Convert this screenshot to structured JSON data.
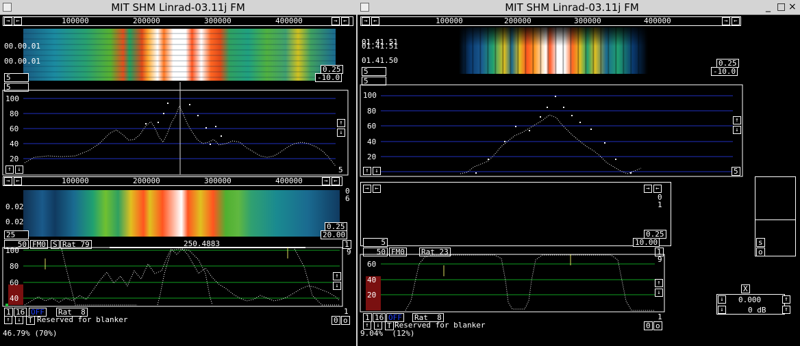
{
  "left": {
    "title": "MIT SHM Linrad-03.11j FM",
    "freq_ticks": [
      "100000",
      "200000",
      "300000",
      "400000"
    ],
    "wf_times": [
      "00.00.01",
      "00.00.01"
    ],
    "wf_value_top": "0.25",
    "wf_value_bottom": "-10.0",
    "avg_top": "5",
    "avg_bottom": "5",
    "spec_y_ticks": [
      "100",
      "80",
      "60",
      "40",
      "20"
    ],
    "spec_corner_value": "5",
    "bb_freq_ticks": [
      "100000",
      "200000",
      "300000",
      "400000"
    ],
    "bb_right_values": [
      "0",
      "6"
    ],
    "bb_times": [
      "0.02",
      "0.02"
    ],
    "bb_value_top": "0.25",
    "bb_value_bottom": "20.00",
    "bb_avg": "25",
    "ctl_num": "50",
    "ctl_mode": "FM0",
    "ctl_s": "S",
    "ctl_rat": "Rat 79",
    "ctl_freq": "250.4883",
    "ctl_one": "1",
    "ctl_nine": "9",
    "bb_y_ticks": [
      "100",
      "80",
      "60",
      "40"
    ],
    "bottom_one": "1",
    "bottom_sixteen": "16",
    "bottom_off": "OFF",
    "bottom_rat": "Rat  8",
    "bottom_one_right": "1",
    "bottom_t": "T",
    "blanker_text": "Reserved for blanker",
    "zero_box": "0",
    "o_box": "o",
    "cpu": "46.79% (70%)"
  },
  "right": {
    "title": "MIT SHM Linrad-03.11j FM",
    "win_controls": [
      "_",
      "□",
      "×"
    ],
    "freq_ticks": [
      "100000",
      "200000",
      "300000",
      "400000"
    ],
    "wf_times": [
      "01.41.51",
      "01.41.51",
      "01.41.50"
    ],
    "wf_value_top": "0.25",
    "wf_value_bottom": "-10.0",
    "avg_top": "5",
    "avg_bottom": "5",
    "spec_y_ticks": [
      "100",
      "80",
      "60",
      "40",
      "20"
    ],
    "spec_corner_value": "5",
    "bb_right_values": [
      "0",
      "1"
    ],
    "bb_value_top": "0.25",
    "bb_value_bottom": "10.00",
    "bb_avg": "5",
    "ctl_num": "50",
    "ctl_mode": "FM0",
    "ctl_rat": "Rat 23",
    "ctl_one": "1",
    "ctl_nine": "9",
    "bb_y_ticks": [
      "60",
      "40",
      "20"
    ],
    "bottom_one": "1",
    "bottom_sixteen": "16",
    "bottom_off": "OFF",
    "bottom_rat": "Rat  8",
    "bottom_one_right": "1",
    "bottom_t": "T",
    "blanker_text": "Reserved for blanker",
    "zero_box": "0",
    "o_box": "o",
    "cpu": "9.04%  (12%)",
    "s_btn": "s",
    "o_btn": "o",
    "x_btn": "X",
    "gain_value": "0.000",
    "db_value": "0 dB"
  }
}
